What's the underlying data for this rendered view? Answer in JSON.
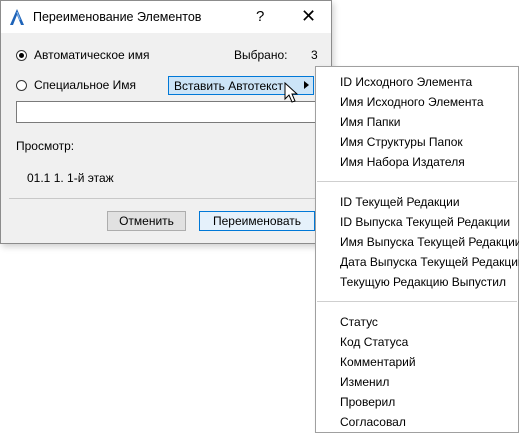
{
  "dialog": {
    "title": "Переименование Элементов",
    "help": "?",
    "close": "✕",
    "auto_name_label": "Автоматическое имя",
    "selected_label": "Выбрано:",
    "selected_count": "3",
    "custom_name_label": "Специальное Имя",
    "autotext_button": "Вставить Автотекст",
    "name_input_value": "",
    "preview_label": "Просмотр:",
    "preview_value": "01.1 1. 1-й этаж",
    "cancel_button": "Отменить",
    "rename_button": "Переименовать",
    "selected_radio": "auto"
  },
  "menu": {
    "group1": [
      "ID Исходного Элемента",
      "Имя Исходного Элемента",
      "Имя Папки",
      "Имя Структуры Папок",
      "Имя Набора Издателя"
    ],
    "group2": [
      "ID Текущей Редакции",
      "ID Выпуска Текущей Редакции",
      "Имя Выпуска Текущей Редакции",
      "Дата Выпуска Текущей Редакции",
      "Текущую Редакцию Выпустил"
    ],
    "group3": [
      "Статус",
      "Код Статуса",
      "Комментарий",
      "Изменил",
      "Проверил",
      "Согласовал"
    ]
  },
  "colors": {
    "accent": "#0078d7",
    "button_highlight": "#cce4f7",
    "dialog_bg": "#f0f0f0"
  }
}
